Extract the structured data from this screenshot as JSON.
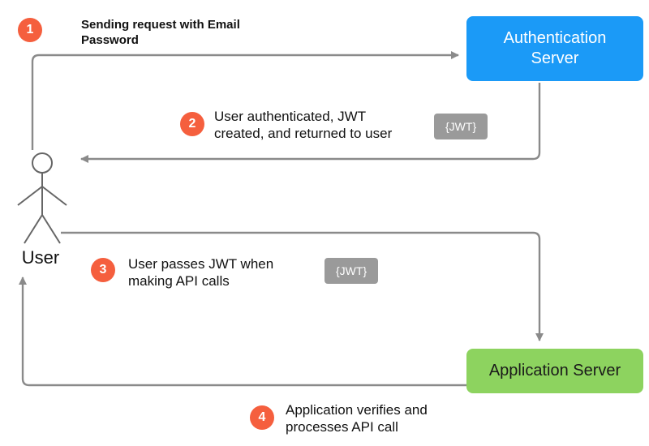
{
  "actors": {
    "user": "User",
    "auth_server": "Authentication Server",
    "app_server": "Application Server"
  },
  "steps": {
    "s1": {
      "num": "1",
      "text": "Sending request with Email Password"
    },
    "s2": {
      "num": "2",
      "text": "User authenticated, JWT created, and returned to user"
    },
    "s3": {
      "num": "3",
      "text": "User passes JWT when making API calls"
    },
    "s4": {
      "num": "4",
      "text": "Application verifies and processes API call"
    }
  },
  "tokens": {
    "jwt_label": "{JWT}"
  },
  "colors": {
    "badge": "#f55f3e",
    "auth_server": "#1b9af7",
    "app_server": "#8dd35f",
    "wire": "#8a8a8a",
    "jwt_bg": "#9a9a9a"
  }
}
